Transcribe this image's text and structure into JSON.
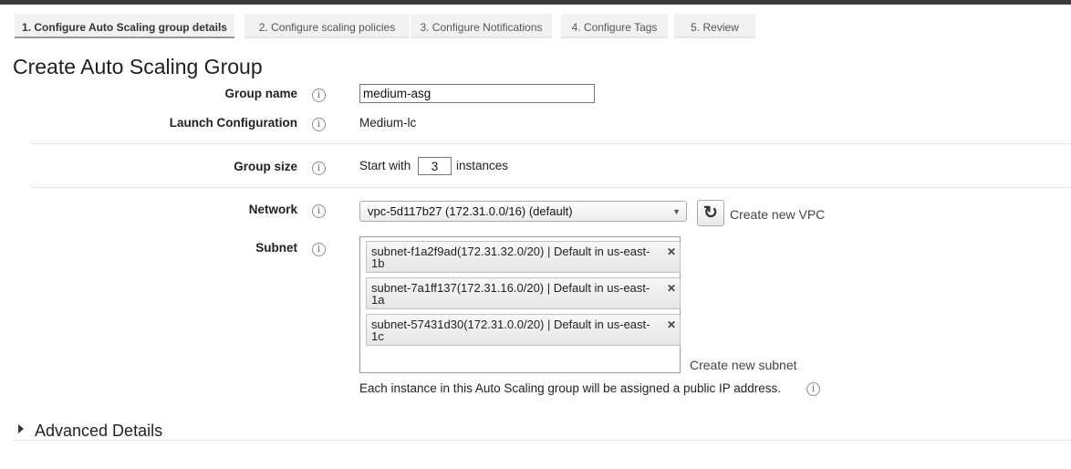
{
  "wizard": {
    "steps": [
      {
        "label": "1. Configure Auto Scaling group details",
        "active": true
      },
      {
        "label": "2. Configure scaling policies",
        "active": false
      },
      {
        "label": "3. Configure Notifications",
        "active": false
      },
      {
        "label": "4. Configure Tags",
        "active": false
      },
      {
        "label": "5. Review",
        "active": false
      }
    ]
  },
  "page": {
    "title": "Create Auto Scaling Group"
  },
  "form": {
    "group_name": {
      "label": "Group name",
      "value": "medium-asg"
    },
    "launch_configuration": {
      "label": "Launch Configuration",
      "value": "Medium-lc"
    },
    "group_size": {
      "label": "Group size",
      "prefix": "Start with",
      "value": "3",
      "suffix": "instances"
    },
    "network": {
      "label": "Network",
      "selected": "vpc-5d117b27 (172.31.0.0/16) (default)",
      "create_link": "Create new VPC"
    },
    "subnet": {
      "label": "Subnet",
      "items": [
        {
          "line1": "subnet-f1a2f9ad(172.31.32.0/20) | Default in us-east-",
          "line2": "1b"
        },
        {
          "line1": "subnet-7a1ff137(172.31.16.0/20) | Default in us-east-",
          "line2": "1a"
        },
        {
          "line1": "subnet-57431d30(172.31.0.0/20) | Default in us-east-",
          "line2": "1c"
        }
      ],
      "remove_glyph": "✕",
      "create_link": "Create new subnet",
      "note": "Each instance in this Auto Scaling group will be assigned a public IP address."
    }
  },
  "advanced": {
    "label": "Advanced Details",
    "expanded": false
  },
  "icons": {
    "info": "i",
    "refresh": "C",
    "dropdown": "▼"
  }
}
